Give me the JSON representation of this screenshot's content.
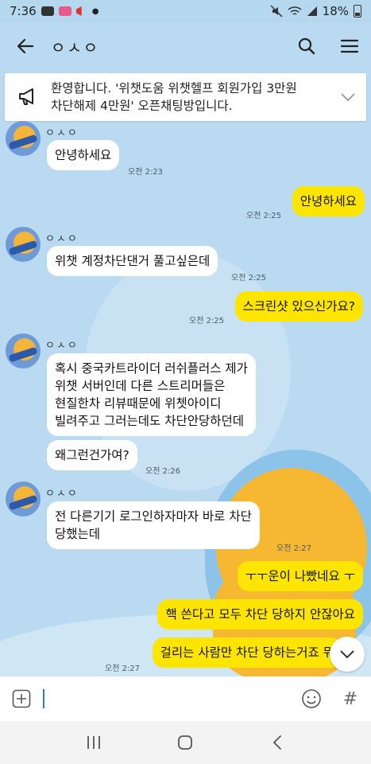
{
  "status_bar": {
    "time": "7:36",
    "battery": "18%",
    "icons": [
      "youtube-icon",
      "app-icon",
      "megaphone-icon",
      "mute-icon",
      "wifi-icon",
      "signal-icon",
      "battery-icon"
    ]
  },
  "header": {
    "title": "ㅇㅅㅇ",
    "icons": [
      "back-arrow-icon",
      "search-icon",
      "menu-icon"
    ]
  },
  "notice": {
    "text_line1": "환영합니다. '위챗도움 위챗헬프 회원가입 3만원",
    "text_line2": "차단해제 4만원' 오픈채팅방입니다.",
    "icons": [
      "megaphone-icon",
      "chevron-down-icon"
    ]
  },
  "messages": {
    "m1": {
      "sender": "ㅇㅅㅇ",
      "text": "안녕하세요",
      "time": "오전 2:23"
    },
    "m2": {
      "text": "안녕하세요",
      "time": "오전 2:25"
    },
    "m3": {
      "sender": "ㅇㅅㅇ",
      "text": "위챗 계정차단댄거 풀고싶은데",
      "time": "오전 2:25"
    },
    "m4": {
      "text": "스크린샷 있으신가요?",
      "time": "오전 2:25"
    },
    "m5": {
      "sender": "ㅇㅅㅇ",
      "line1": "혹시 중국카트라이더 러쉬플러스 제가",
      "line2": "위챗 서버인데  다른 스트리머들은",
      "line3": "현질한차  리뷰때문에 위쳇아이디",
      "line4": "빌려주고 그러는데도 차단안당하던데"
    },
    "m6": {
      "text": "왜그런건가여?",
      "time": "오전 2:26"
    },
    "m7": {
      "sender": "ㅇㅅㅇ",
      "line1": "전 다른기기 로그인하자마자 바로 차단",
      "line2": "당했는데",
      "time": "오전 2:27"
    },
    "m8": {
      "text": "ㅜㅜ운이 나빴네요 ㅜ"
    },
    "m9": {
      "text": "핵 쓴다고 모두 차단 당하지 안잖아요"
    },
    "m10": {
      "text": "걸리는 사람만 차단 당하는거죠 뭐",
      "time": "오전 2:27"
    }
  },
  "input": {
    "value": "",
    "placeholder": "",
    "icons": [
      "plus-icon",
      "emoji-icon",
      "hashtag-icon"
    ],
    "hash_glyph": "#"
  },
  "nav": {
    "icons": [
      "recent-apps-icon",
      "home-icon",
      "back-icon"
    ]
  },
  "colors": {
    "background": "#b9daf0",
    "incoming_bubble": "#ffffff",
    "outgoing_bubble": "#fee500",
    "input_bar": "#ffffff",
    "nav_bar": "#f3f3f3"
  }
}
